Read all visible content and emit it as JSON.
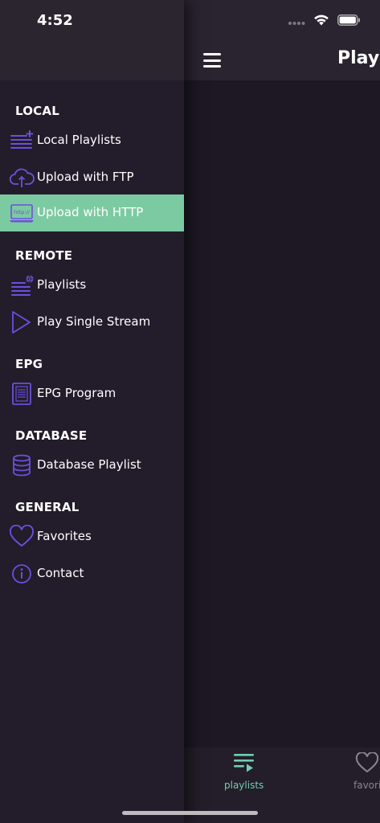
{
  "status": {
    "time": "4:52"
  },
  "main": {
    "title": "Playl",
    "tabs": [
      {
        "label": "playlists",
        "icon": "playlist-icon",
        "active": true
      },
      {
        "label": "favori",
        "icon": "heart-icon",
        "active": false
      }
    ]
  },
  "drawer": {
    "sections": [
      {
        "title": "LOCAL",
        "items": [
          {
            "label": "Local Playlists",
            "icon": "local-playlist-icon"
          },
          {
            "label": "Upload with FTP",
            "icon": "cloud-upload-icon"
          },
          {
            "label": "Upload with HTTP",
            "icon": "http-laptop-icon",
            "active": true,
            "icon_text": "http://"
          }
        ]
      },
      {
        "title": "REMOTE",
        "items": [
          {
            "label": "Playlists",
            "icon": "remote-playlist-icon"
          },
          {
            "label": "Play Single Stream",
            "icon": "play-icon"
          }
        ]
      },
      {
        "title": "EPG",
        "items": [
          {
            "label": "EPG Program",
            "icon": "epg-book-icon"
          }
        ]
      },
      {
        "title": "DATABASE",
        "items": [
          {
            "label": "Database Playlist",
            "icon": "database-icon"
          }
        ]
      },
      {
        "title": "GENERAL",
        "items": [
          {
            "label": "Favorites",
            "icon": "heart-icon"
          },
          {
            "label": "Contact",
            "icon": "info-icon"
          }
        ]
      }
    ]
  },
  "colors": {
    "accent": "#7ccaa2",
    "icon_purple": "#6c4fe0",
    "drawer_bg": "#231c2b",
    "main_bg": "#1d1823",
    "tab_active": "#6fcfb0",
    "tab_inactive": "#8a8590"
  }
}
